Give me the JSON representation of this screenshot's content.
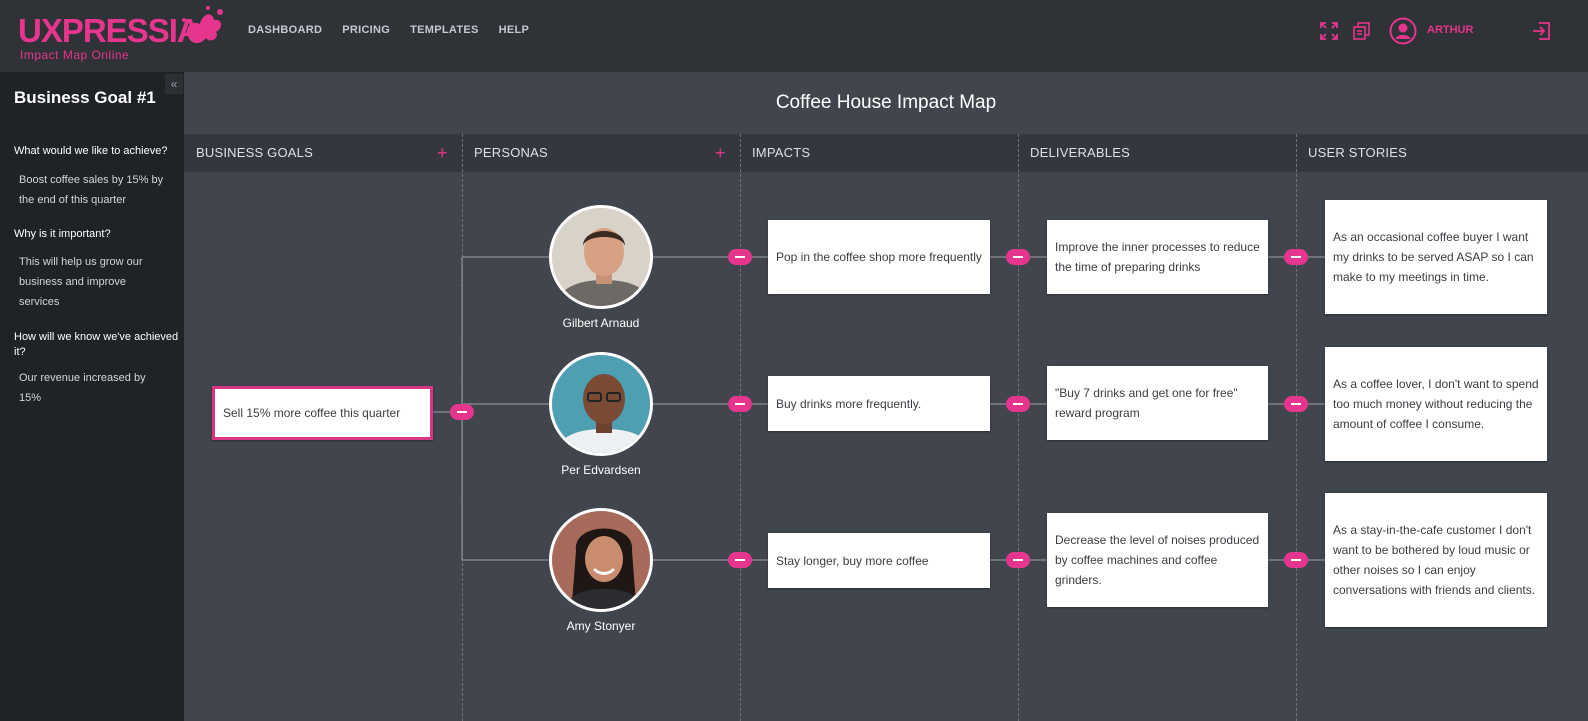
{
  "app": {
    "logo_main": "UXPRESSIA",
    "logo_sub": "Impact Map Online",
    "nav": [
      "DASHBOARD",
      "PRICING",
      "TEMPLATES",
      "HELP"
    ],
    "user": "ARTHUR"
  },
  "icons": {
    "fullscreen": "fullscreen-icon",
    "copy": "copy-icon",
    "avatar": "user-avatar-icon",
    "logout": "logout-icon",
    "collapse": "double-chevron-left-icon",
    "add": "plus-icon",
    "toggle": "minus-pill-icon"
  },
  "colors": {
    "accent": "#e6358c",
    "topbar": "#2f3237",
    "canvas": "#41454d",
    "sidebar": "#1f2226"
  },
  "sidebar": {
    "collapse": "«",
    "title": "Business Goal #1",
    "items": [
      {
        "question": "What would we like to achieve?",
        "answer": "Boost coffee sales by 15% by the end of this quarter"
      },
      {
        "question": "Why is it important?",
        "answer": "This will help us grow our business and improve services"
      },
      {
        "question": "How will we know we've achieved it?",
        "answer": "Our revenue increased by 15%"
      }
    ]
  },
  "map": {
    "title": "Coffee House Impact Map",
    "columns": [
      "BUSINESS GOALS",
      "PERSONAS",
      "IMPACTS",
      "DELIVERABLES",
      "USER STORIES"
    ],
    "add_label": "+",
    "goal": "Sell 15% more coffee this quarter",
    "personas": [
      "Gilbert Arnaud",
      "Per Edvardsen",
      "Amy Stonyer"
    ],
    "impacts": [
      "Pop in the coffee shop more frequently",
      "Buy drinks more frequently.",
      "Stay longer, buy more coffee"
    ],
    "deliverables": [
      "Improve the inner processes to reduce the time of preparing drinks",
      "\"Buy 7 drinks and get one for free\" reward program",
      "Decrease the level of noises produced by coffee machines and coffee grinders."
    ],
    "stories": [
      "As an occasional coffee buyer I want my drinks to be served ASAP so I can make to my meetings in time.",
      "As a coffee lover, I don't want to spend too much money without reducing the amount of coffee I consume.",
      "As a stay-in-the-cafe customer I don't want to be bothered by loud music or other noises so I can enjoy conversations with friends and clients."
    ]
  }
}
